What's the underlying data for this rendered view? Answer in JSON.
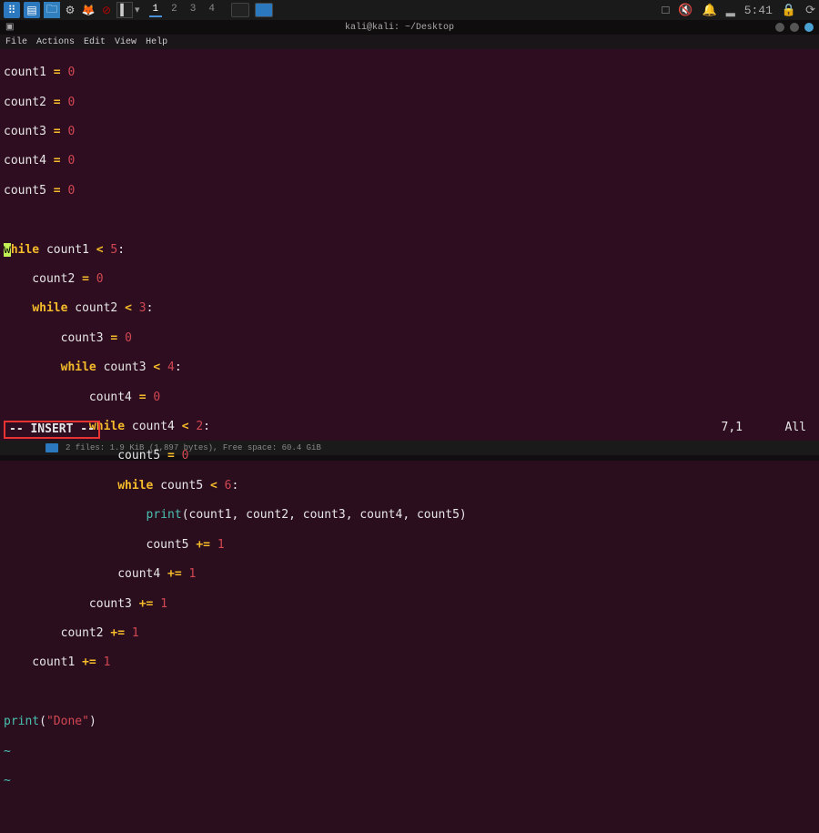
{
  "taskbar": {
    "workspaces": [
      "1",
      "2",
      "3",
      "4"
    ],
    "active_workspace": 0,
    "time": "5:41",
    "tray": {
      "sound": "muted",
      "notifications": "on",
      "wifi": "off"
    }
  },
  "window": {
    "app_icon": "terminal-icon",
    "title": "kali@kali: ~/Desktop",
    "menubar": [
      "File",
      "Actions",
      "Edit",
      "View",
      "Help"
    ],
    "controls": [
      "minimize",
      "maximize",
      "close"
    ]
  },
  "editor": {
    "mode": "-- INSERT --",
    "cursor": "7,1",
    "view": "All",
    "lines": {
      "l1": {
        "a": "count1 ",
        "b": "=",
        "c": " ",
        "d": "0"
      },
      "l2": {
        "a": "count2 ",
        "b": "=",
        "c": " ",
        "d": "0"
      },
      "l3": {
        "a": "count3 ",
        "b": "=",
        "c": " ",
        "d": "0"
      },
      "l4": {
        "a": "count4 ",
        "b": "=",
        "c": " ",
        "d": "0"
      },
      "l5": {
        "a": "count5 ",
        "b": "=",
        "c": " ",
        "d": "0"
      },
      "l7": {
        "a": "w",
        "b": "hile",
        "c": " count1 ",
        "d": "<",
        "e": " ",
        "f": "5",
        "g": ":"
      },
      "l8": {
        "a": "    count2 ",
        "b": "=",
        "c": " ",
        "d": "0"
      },
      "l9": {
        "a": "    ",
        "b": "while",
        "c": " count2 ",
        "d": "<",
        "e": " ",
        "f": "3",
        "g": ":"
      },
      "l10": {
        "a": "        count3 ",
        "b": "=",
        "c": " ",
        "d": "0"
      },
      "l11": {
        "a": "        ",
        "b": "while",
        "c": " count3 ",
        "d": "<",
        "e": " ",
        "f": "4",
        "g": ":"
      },
      "l12": {
        "a": "            count4 ",
        "b": "=",
        "c": " ",
        "d": "0"
      },
      "l13": {
        "a": "            ",
        "b": "while",
        "c": " count4 ",
        "d": "<",
        "e": " ",
        "f": "2",
        "g": ":"
      },
      "l14": {
        "a": "                count5 ",
        "b": "=",
        "c": " ",
        "d": "0"
      },
      "l15": {
        "a": "                ",
        "b": "while",
        "c": " count5 ",
        "d": "<",
        "e": " ",
        "f": "6",
        "g": ":"
      },
      "l16": {
        "a": "                    ",
        "b": "print",
        "c": "(count1, count2, count3, count4, count5)"
      },
      "l17": {
        "a": "                    count5 ",
        "b": "+=",
        "c": " ",
        "d": "1"
      },
      "l18": {
        "a": "                count4 ",
        "b": "+=",
        "c": " ",
        "d": "1"
      },
      "l19": {
        "a": "            count3 ",
        "b": "+=",
        "c": " ",
        "d": "1"
      },
      "l20": {
        "a": "        count2 ",
        "b": "+=",
        "c": " ",
        "d": "1"
      },
      "l21": {
        "a": "    count1 ",
        "b": "+=",
        "c": " ",
        "d": "1"
      },
      "l23": {
        "a": "print",
        "b": "(",
        "c": "\"Done\"",
        "d": ")"
      },
      "tilde": "~"
    }
  },
  "bottombar": {
    "text": "2 files: 1.9 KiB (1,897 bytes), Free space: 60.4 GiB"
  }
}
